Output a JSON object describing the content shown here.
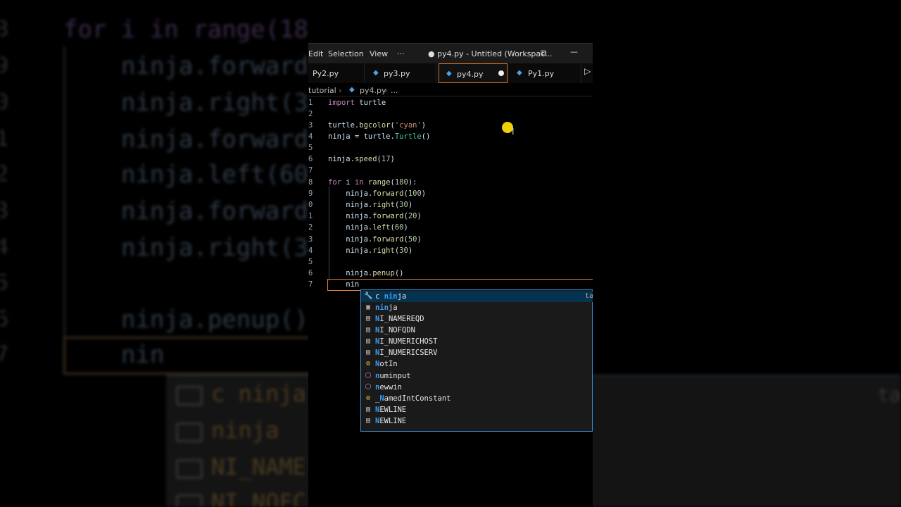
{
  "background": {
    "line_numbers": [
      "8",
      "9",
      "0",
      "1",
      "2",
      "3",
      "4",
      "5",
      "6",
      "7"
    ],
    "code_lines": [
      "for i in range(18",
      "ninja.forward",
      "ninja.right(3",
      "ninja.forward",
      "ninja.left(60",
      "ninja.forward",
      "ninja.right(3",
      "",
      "ninja.penup()",
      "nin"
    ],
    "suggestions": [
      "c ninja",
      "ninja",
      "NI_NAME",
      "NI_NOFC"
    ],
    "trailing": "ta"
  },
  "titlebar": {
    "menu": [
      "Edit",
      "Selection",
      "View",
      "···"
    ],
    "title": "● py4.py - Untitled (Workspac...",
    "layout_icon": "layout-icon",
    "minimize": "—"
  },
  "tabs": [
    {
      "label": "Py2.py",
      "active": false
    },
    {
      "label": "py3.py",
      "active": false
    },
    {
      "label": "py4.py",
      "active": true,
      "modified": true
    },
    {
      "label": "Py1.py",
      "active": false
    }
  ],
  "breadcrumb": {
    "folder": "tutorial",
    "file": "py4.py",
    "more": "..."
  },
  "editor": {
    "line_numbers": [
      "1",
      "2",
      "3",
      "4",
      "5",
      "6",
      "7",
      "8",
      "9",
      "0",
      "1",
      "2",
      "3",
      "4",
      "5",
      "6",
      "7"
    ],
    "lines": [
      "import turtle",
      "",
      "turtle.bgcolor('cyan')",
      "ninja = turtle.Turtle()",
      "",
      "ninja.speed(17)",
      "",
      "for i in range(180):",
      "    ninja.forward(100)",
      "    ninja.right(30)",
      "    ninja.forward(20)",
      "    ninja.left(60)",
      "    ninja.forward(50)",
      "    ninja.right(30)",
      "",
      "    ninja.penup()",
      "    nin"
    ]
  },
  "suggest": {
    "trailing": "ta",
    "items": [
      {
        "icon": "wrench-icon",
        "prefix": "c ",
        "match": "nin",
        "rest": "ja"
      },
      {
        "icon": "variable-icon",
        "prefix": "",
        "match": "nin",
        "rest": "ja"
      },
      {
        "icon": "constant-icon",
        "prefix": "",
        "match": "N",
        "rest": "I_NAMEREQD"
      },
      {
        "icon": "constant-icon",
        "prefix": "",
        "match": "N",
        "rest": "I_NOFQDN"
      },
      {
        "icon": "constant-icon",
        "prefix": "",
        "match": "N",
        "rest": "I_NUMERICHOST"
      },
      {
        "icon": "constant-icon",
        "prefix": "",
        "match": "N",
        "rest": "I_NUMERICSERV"
      },
      {
        "icon": "class-icon",
        "prefix": "",
        "match": "N",
        "rest": "otIn"
      },
      {
        "icon": "module-icon",
        "prefix": "",
        "match": "n",
        "rest": "uminput"
      },
      {
        "icon": "module-icon",
        "prefix": "",
        "match": "n",
        "rest": "ewwin"
      },
      {
        "icon": "class-icon",
        "prefix": "_",
        "match": "N",
        "rest": "amedIntConstant"
      },
      {
        "icon": "constant-icon",
        "prefix": "",
        "match": "N",
        "rest": "EWLINE"
      },
      {
        "icon": "constant-icon",
        "prefix": "",
        "match": "N",
        "rest": "EWLINE"
      }
    ]
  },
  "colors": {
    "accent_orange": "#e0823a",
    "accent_blue": "#3a8fd6",
    "match_blue": "#3a9cf0",
    "cursor_yellow": "#f0d000"
  }
}
